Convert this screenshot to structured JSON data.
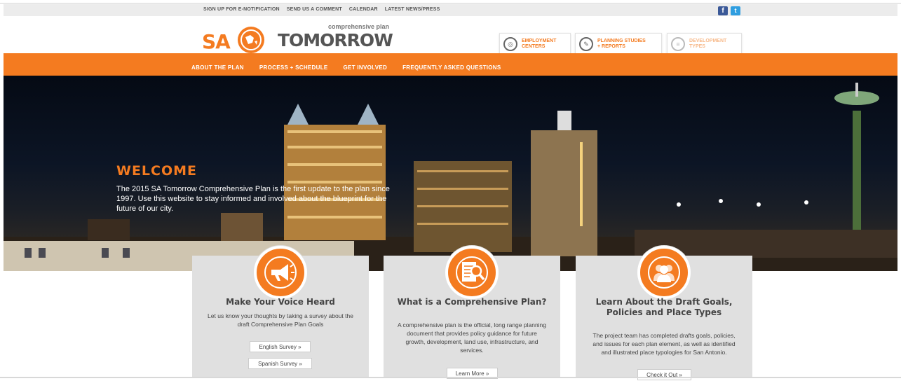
{
  "utility_nav": {
    "links": [
      "SIGN UP FOR E-NOTIFICATION",
      "SEND US A COMMENT",
      "CALENDAR",
      "LATEST NEWS/PRESS"
    ],
    "social": [
      {
        "icon": "facebook-icon",
        "glyph": "f"
      },
      {
        "icon": "twitter-icon",
        "glyph": "t"
      }
    ]
  },
  "logo": {
    "left": "SA",
    "right": "TOMORROW",
    "tagline": "comprehensive plan"
  },
  "quick_links": [
    {
      "line1": "EMPLOYMENT",
      "line2": "CENTERS",
      "icon": "target-icon"
    },
    {
      "line1": "PLANNING STUDIES",
      "line2": "+ REPORTS",
      "icon": "pencil-icon"
    },
    {
      "line1": "DEVELOPMENT",
      "line2": "TYPES",
      "icon": "layers-icon"
    }
  ],
  "main_nav": [
    "ABOUT THE PLAN",
    "PROCESS + SCHEDULE",
    "GET INVOLVED",
    "FREQUENTLY ASKED QUESTIONS"
  ],
  "hero": {
    "heading": "WELCOME",
    "text": "The 2015 SA Tomorrow Comprehensive Plan is the first update to the plan since 1997. Use this website to stay informed and involved about the blueprint for the future of our city."
  },
  "cards": [
    {
      "title": "Make Your Voice Heard",
      "body": "Let us know your thoughts by taking a survey about the draft Comprehensive Plan Goals",
      "buttons": [
        "English Survey »",
        "Spanish Survey »"
      ],
      "icon": "megaphone-icon"
    },
    {
      "title": "What is a Comprehensive Plan?",
      "body": "A comprehensive plan is the official, long range planning document that provides policy guidance for future growth, development, land use, infrastructure, and services.",
      "buttons": [
        "Learn More »"
      ],
      "icon": "document-search-icon"
    },
    {
      "title": "Learn About the Draft Goals, Policies and Place Types",
      "body": "The project team has completed drafts goals, policies, and issues for each plan element, as well as identified and illustrated place typologies for San Antonio.",
      "buttons": [
        "Check it Out »"
      ],
      "icon": "people-icon"
    }
  ],
  "colors": {
    "accent": "#f47b20",
    "utility_bar": "#ececec",
    "card_bg": "#e0e0e0"
  }
}
